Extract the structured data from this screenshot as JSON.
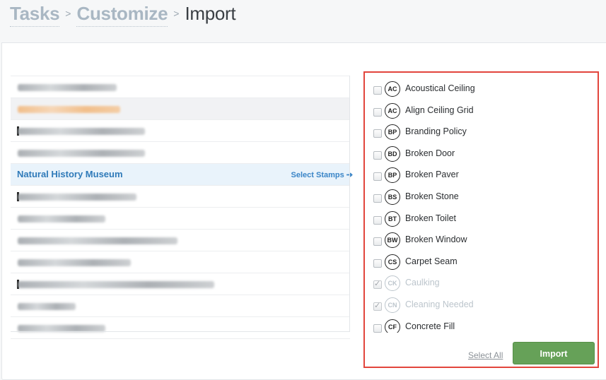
{
  "breadcrumb": {
    "items": [
      "Tasks",
      "Customize",
      "Import"
    ],
    "separator": ">"
  },
  "projects": {
    "active_name": "Natural History Museum",
    "select_stamps_label": "Select Stamps",
    "select_stamps_icon": "arrow-right-icon"
  },
  "stamps": {
    "items": [
      {
        "code": "AC",
        "label": "Acoustical Ceiling",
        "checked": false,
        "disabled": false
      },
      {
        "code": "AC",
        "label": "Align Ceiling Grid",
        "checked": false,
        "disabled": false
      },
      {
        "code": "BP",
        "label": "Branding Policy",
        "checked": false,
        "disabled": false
      },
      {
        "code": "BD",
        "label": "Broken Door",
        "checked": false,
        "disabled": false
      },
      {
        "code": "BP",
        "label": "Broken Paver",
        "checked": false,
        "disabled": false
      },
      {
        "code": "BS",
        "label": "Broken Stone",
        "checked": false,
        "disabled": false
      },
      {
        "code": "BT",
        "label": "Broken Toilet",
        "checked": false,
        "disabled": false
      },
      {
        "code": "BW",
        "label": "Broken Window",
        "checked": false,
        "disabled": false
      },
      {
        "code": "CS",
        "label": "Carpet Seam",
        "checked": false,
        "disabled": false
      },
      {
        "code": "CK",
        "label": "Caulking",
        "checked": true,
        "disabled": true
      },
      {
        "code": "CN",
        "label": "Cleaning Needed",
        "checked": true,
        "disabled": true
      },
      {
        "code": "CF",
        "label": "Concrete Fill",
        "checked": false,
        "disabled": false
      }
    ],
    "select_all_label": "Select All",
    "import_label": "Import"
  },
  "colors": {
    "accent_blue": "#2f7ab9",
    "import_green": "#66a158",
    "highlight_red": "#e2453c"
  }
}
